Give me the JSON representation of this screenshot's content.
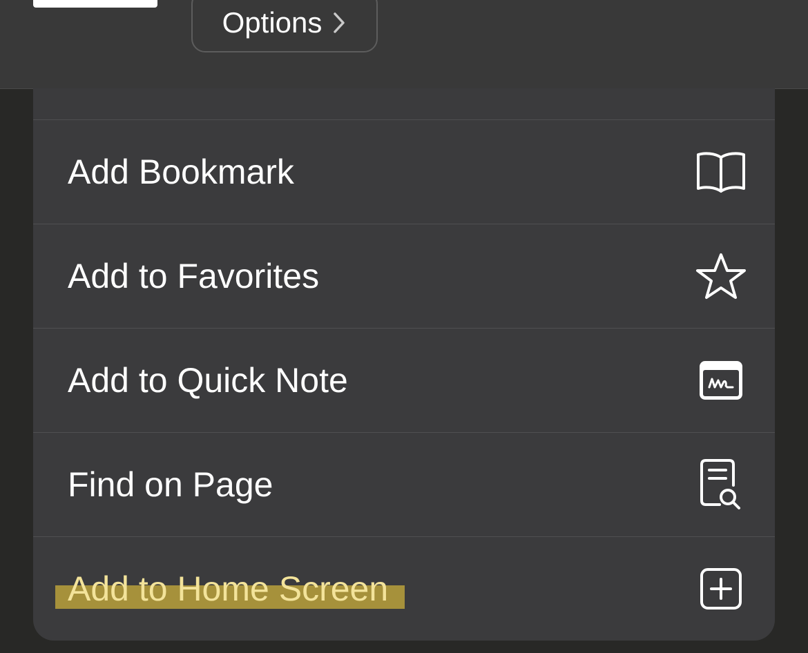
{
  "header": {
    "options_label": "Options"
  },
  "menu": {
    "items": [
      {
        "label": "Add Bookmark",
        "icon": "book-icon",
        "highlighted": false
      },
      {
        "label": "Add to Favorites",
        "icon": "star-icon",
        "highlighted": false
      },
      {
        "label": "Add to Quick Note",
        "icon": "quick-note-icon",
        "highlighted": false
      },
      {
        "label": "Find on Page",
        "icon": "find-on-page-icon",
        "highlighted": false
      },
      {
        "label": "Add to Home Screen",
        "icon": "add-square-icon",
        "highlighted": true
      }
    ]
  },
  "colors": {
    "highlight": "#a6913b",
    "highlight_text": "#f3e39a",
    "menu_background": "#3b3b3d"
  }
}
